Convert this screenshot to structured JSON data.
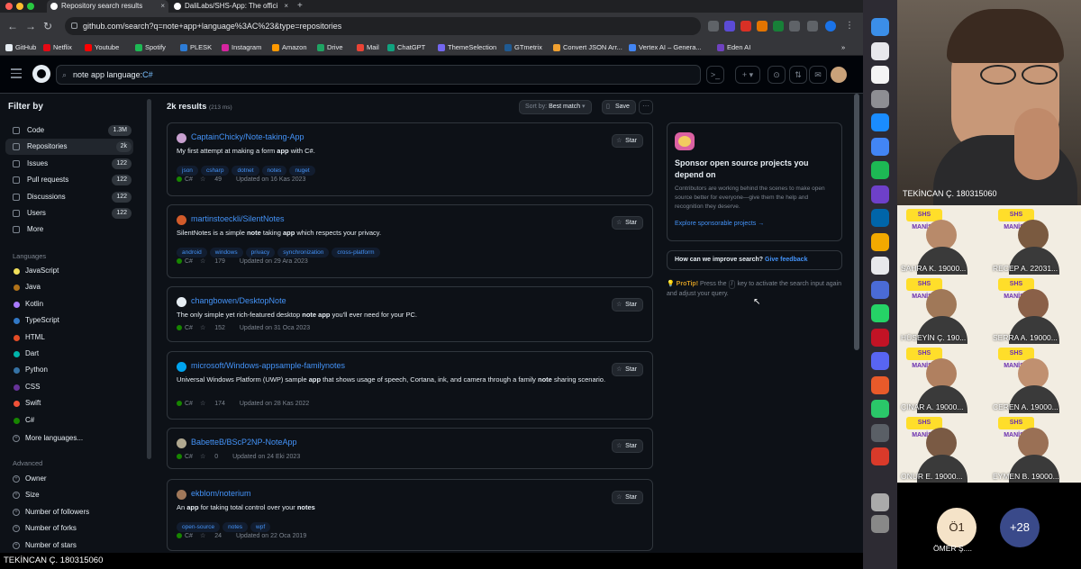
{
  "browser": {
    "tabs": [
      {
        "label": "Repository search results"
      },
      {
        "label": "DaliLabs/SHS-App: The offici"
      }
    ],
    "url": "github.com/search?q=note+app+language%3AC%23&type=repositories",
    "bookmarks": [
      "GitHub",
      "Netflix",
      "Youtube",
      "Spotify",
      "PLESK",
      "Instagram",
      "Amazon",
      "Drive",
      "Mail",
      "ChatGPT",
      "ThemeSelection",
      "GTmetrix",
      "Convert JSON Arr...",
      "Vertex AI – Genera...",
      "Eden AI"
    ],
    "bookmark_colors": [
      "#e6edf3",
      "#e50914",
      "#ff0000",
      "#1db954",
      "#2d7cd6",
      "#d6249f",
      "#ff9900",
      "#1fa463",
      "#ea4335",
      "#10a37f",
      "#7367f0",
      "#1f5a92",
      "#f0a030",
      "#4285f4",
      "#6f42c1"
    ]
  },
  "github": {
    "search_query_prefix": "note app language:",
    "search_query_lang": "C#",
    "sidebar": {
      "title": "Filter by",
      "types": [
        {
          "label": "Code",
          "count": "1.3M",
          "active": false
        },
        {
          "label": "Repositories",
          "count": "2k",
          "active": true
        },
        {
          "label": "Issues",
          "count": "122",
          "active": false
        },
        {
          "label": "Pull requests",
          "count": "122",
          "active": false
        },
        {
          "label": "Discussions",
          "count": "122",
          "active": false
        },
        {
          "label": "Users",
          "count": "122",
          "active": false
        },
        {
          "label": "More",
          "count": "",
          "active": false
        }
      ],
      "languages_heading": "Languages",
      "languages": [
        {
          "label": "JavaScript",
          "color": "#f1e05a"
        },
        {
          "label": "Java",
          "color": "#b07219"
        },
        {
          "label": "Kotlin",
          "color": "#a97bff"
        },
        {
          "label": "TypeScript",
          "color": "#3178c6"
        },
        {
          "label": "HTML",
          "color": "#e34c26"
        },
        {
          "label": "Dart",
          "color": "#00b4ab"
        },
        {
          "label": "Python",
          "color": "#3572a5"
        },
        {
          "label": "CSS",
          "color": "#663399"
        },
        {
          "label": "Swift",
          "color": "#f05138"
        },
        {
          "label": "C#",
          "color": "#178600"
        }
      ],
      "more_languages": "More languages...",
      "advanced_heading": "Advanced",
      "advanced": [
        "Owner",
        "Size",
        "Number of followers",
        "Number of forks",
        "Number of stars"
      ]
    },
    "results": {
      "count": "2k results",
      "time": "(213 ms)",
      "sort_prefix": "Sort by:",
      "sort_value": "Best match",
      "save": "Save",
      "more": "···",
      "items": [
        {
          "owner": "CaptainChicky",
          "repo": "Note-taking-App",
          "desc_html": "My first attempt at making a form <b>app</b> with C#.",
          "topics": [
            "json",
            "csharp",
            "dotnet",
            "notes",
            "nuget"
          ],
          "lang": "C#",
          "stars": "49",
          "updated": "Updated on 16 Kas 2023",
          "avatar_color": "#c8a0d0"
        },
        {
          "owner": "martinstoeckli",
          "repo": "SilentNotes",
          "desc_html": "SilentNotes is a simple <b>note</b> taking <b>app</b> which respects your privacy.",
          "topics": [
            "android",
            "windows",
            "privacy",
            "synchronization",
            "cross-platform"
          ],
          "lang": "C#",
          "stars": "179",
          "updated": "Updated on 29 Ara 2023",
          "avatar_color": "#d25b2a"
        },
        {
          "owner": "changbowen",
          "repo": "DesktopNote",
          "desc_html": "The only simple yet rich-featured desktop <b>note app</b> you'll ever need for your PC.",
          "topics": [],
          "lang": "C#",
          "stars": "152",
          "updated": "Updated on 31 Oca 2023",
          "avatar_color": "#e6edf3"
        },
        {
          "owner": "microsoft",
          "repo": "Windows-appsample-familynotes",
          "desc_html": "Universal Windows Platform (UWP) sample <b>app</b> that shows usage of speech, Cortana, ink, and camera through a family <b>note</b> sharing scenario.",
          "topics": [],
          "lang": "C#",
          "stars": "174",
          "updated": "Updated on 28 Kas 2022",
          "avatar_color": "#00a4ef"
        },
        {
          "owner": "BabetteB",
          "repo": "BScP2NP-NoteApp",
          "desc_html": "",
          "topics": [],
          "lang": "C#",
          "stars": "0",
          "updated": "Updated on 24 Eki 2023",
          "avatar_color": "#b0a890"
        },
        {
          "owner": "ekblom",
          "repo": "noterium",
          "desc_html": "An <b>app</b> for taking total control over your <b>notes</b>",
          "topics": [
            "open-source",
            "notes",
            "wpf"
          ],
          "lang": "C#",
          "stars": "24",
          "updated": "Updated on 22 Oca 2019",
          "avatar_color": "#a0785a"
        }
      ],
      "star_label": "Star"
    },
    "sponsor": {
      "title": "Sponsor open source projects you depend on",
      "body": "Contributors are working behind the scenes to make open source better for everyone—give them the help and recognition they deserve.",
      "link": "Explore sponsorable projects →"
    },
    "improve": {
      "text": "How can we improve search?",
      "link": "Give feedback"
    },
    "protip": {
      "label": "ProTip!",
      "pre": "Press the",
      "key": "/",
      "post": "key to activate the search input again and adjust your query."
    }
  },
  "meeting": {
    "main_name": "TEKİNCAN Ç. 180315060",
    "tiles": [
      {
        "name": "SAHRA K. 19000..."
      },
      {
        "name": "RECEP A. 22031..."
      },
      {
        "name": "HÜSEYİN Ç. 190..."
      },
      {
        "name": "SERRA A. 19000..."
      },
      {
        "name": "ÇINAR A. 19000..."
      },
      {
        "name": "CEREN A. 19000..."
      },
      {
        "name": "ONUR E. 19000..."
      },
      {
        "name": "EYMEN B. 19000..."
      }
    ],
    "tile_logo": "SHS MANİSA",
    "circle_initials": "Ö1",
    "circle_name": "ÖMER Ş....",
    "more_count": "+28",
    "bottom_name": "TEKİNCAN Ç. 180315060"
  }
}
